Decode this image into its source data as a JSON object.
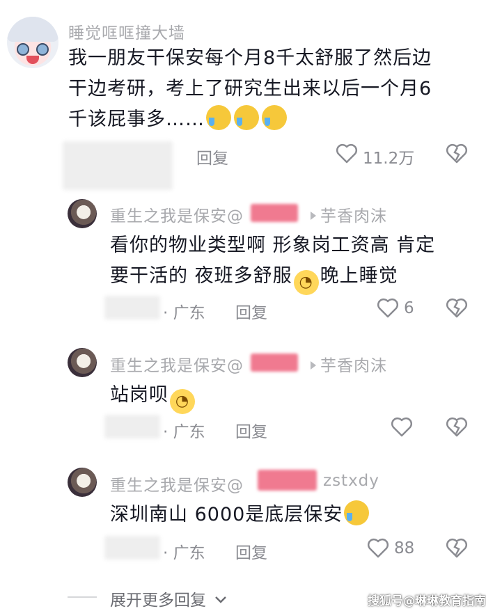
{
  "main_comment": {
    "username": "睡觉哐哐撞大墙",
    "lines": [
      "我一朋友干保安每个月8千太舒服了然后边",
      "干边考研，考上了研究生出来以后一个月6",
      "千该屁事多……"
    ],
    "reply_label": "回复",
    "like_count": "11.2万"
  },
  "replies": [
    {
      "username": "重生之我是保安@",
      "target": "芋香肉沫",
      "lines": [
        "看你的物业类型啊 形象岗工资高 肯定",
        "要干活的 夜班多舒服"
      ],
      "trailing_text": "晚上睡觉",
      "location": "· 广东",
      "reply_label": "回复",
      "like_count": "6"
    },
    {
      "username": "重生之我是保安@",
      "target": "芋香肉沫",
      "lines": [
        "站岗呗"
      ],
      "location": "· 广东",
      "reply_label": "回复",
      "like_count": ""
    },
    {
      "username": "重生之我是保安@",
      "target": "zstxdy",
      "lines": [
        "深圳南山 6000是底层保安"
      ],
      "location": "· 广东",
      "reply_label": "回复",
      "like_count": "88"
    }
  ],
  "expand_label": "展开更多回复",
  "watermark": "搜狐号@琳琳教育指南",
  "colors": {
    "text": "#161823",
    "muted": "#8a8b91",
    "username": "#a8a9ad",
    "emoji": "#f6c83a"
  },
  "icons": [
    "heart-icon",
    "broken-heart-icon",
    "chevron-down-icon",
    "reply-arrow-icon"
  ]
}
